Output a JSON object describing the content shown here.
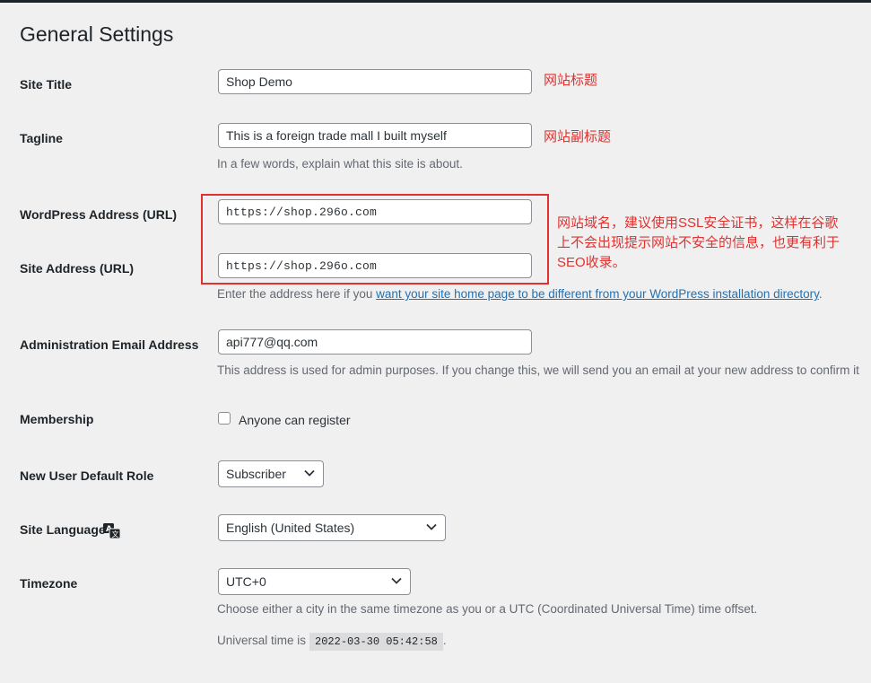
{
  "page": {
    "title": "General Settings"
  },
  "fields": {
    "site_title": {
      "label": "Site Title",
      "value": "Shop Demo"
    },
    "tagline": {
      "label": "Tagline",
      "value": "This is a foreign trade mall I built myself",
      "description": "In a few words, explain what this site is about."
    },
    "wp_address": {
      "label": "WordPress Address (URL)",
      "value": "https://shop.296o.com"
    },
    "site_address": {
      "label": "Site Address (URL)",
      "value": "https://shop.296o.com",
      "description_prefix": "Enter the address here if you ",
      "description_link": "want your site home page to be different from your WordPress installation directory",
      "description_suffix": "."
    },
    "admin_email": {
      "label": "Administration Email Address",
      "value": "api777@qq.com",
      "description": "This address is used for admin purposes. If you change this, we will send you an email at your new address to confirm it"
    },
    "membership": {
      "label": "Membership",
      "checkbox_label": "Anyone can register",
      "checked": false
    },
    "default_role": {
      "label": "New User Default Role",
      "selected": "Subscriber"
    },
    "site_language": {
      "label": "Site Language",
      "selected": "English (United States)",
      "icon": "translation-icon"
    },
    "timezone": {
      "label": "Timezone",
      "selected": "UTC+0",
      "description": "Choose either a city in the same timezone as you or a UTC (Coordinated Universal Time) time offset.",
      "universal_prefix": "Universal time is",
      "universal_time": "2022-03-30 05:42:58",
      "universal_suffix": "."
    }
  },
  "annotations": {
    "site_title": "网站标题",
    "tagline": "网站副标题",
    "address_line1": "网站域名，建议使用SSL安全证书，这样在谷歌",
    "address_line2": "上不会出现提示网站不安全的信息，也更有利于",
    "address_line3": "SEO收录。"
  },
  "colors": {
    "annotation": "#e0312f",
    "link": "#2271b1",
    "background": "#f0f0f1"
  }
}
